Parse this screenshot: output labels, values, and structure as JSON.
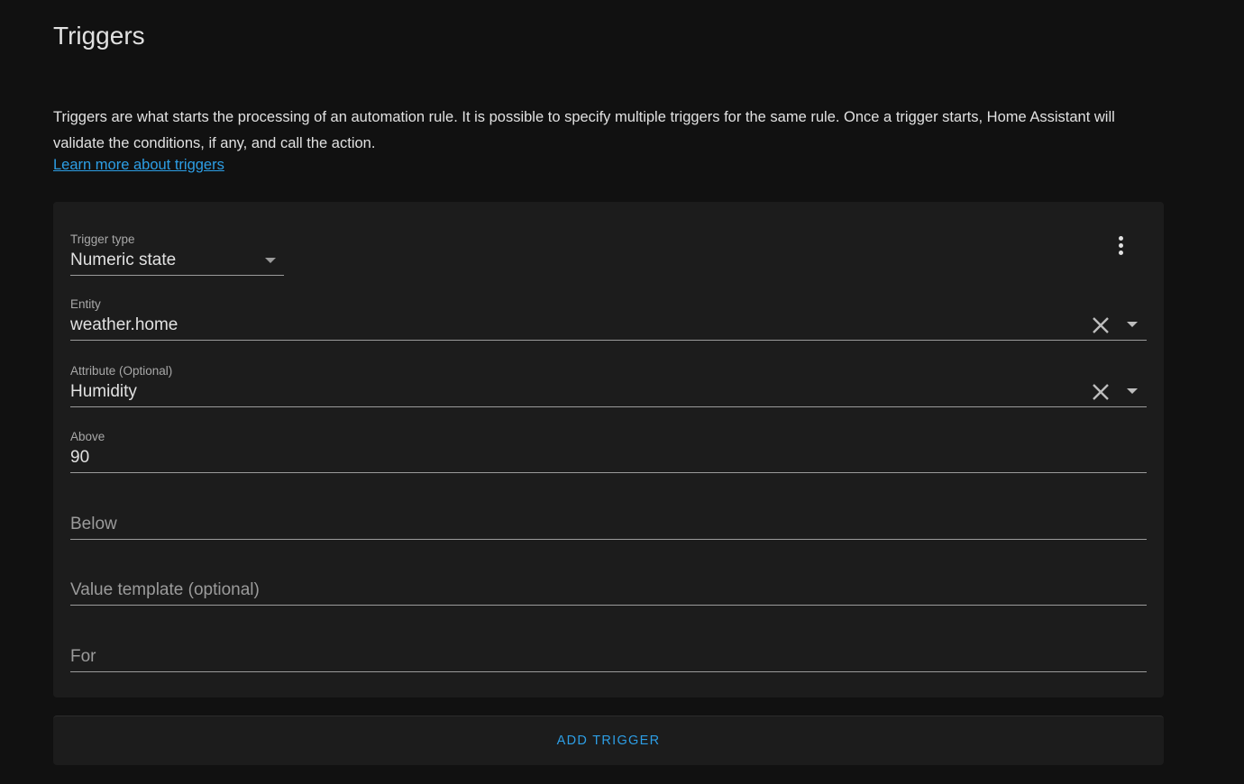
{
  "section": {
    "title": "Triggers",
    "description": "Triggers are what starts the processing of an automation rule. It is possible to specify multiple triggers for the same rule. Once a trigger starts, Home Assistant will validate the conditions, if any, and call the action.",
    "learn_more": "Learn more about triggers"
  },
  "trigger": {
    "menu_icon": "dots-vertical-icon",
    "type": {
      "label": "Trigger type",
      "value": "Numeric state"
    },
    "entity": {
      "label": "Entity",
      "value": "weather.home"
    },
    "attribute": {
      "label": "Attribute (Optional)",
      "value": "Humidity"
    },
    "above": {
      "label": "Above",
      "value": "90"
    },
    "below": {
      "placeholder": "Below"
    },
    "value_template": {
      "placeholder": "Value template (optional)"
    },
    "for": {
      "placeholder": "For"
    }
  },
  "actions": {
    "add_trigger": "ADD TRIGGER"
  },
  "colors": {
    "accent": "#2d9ee5",
    "background": "#111111",
    "card": "#1c1c1c"
  }
}
